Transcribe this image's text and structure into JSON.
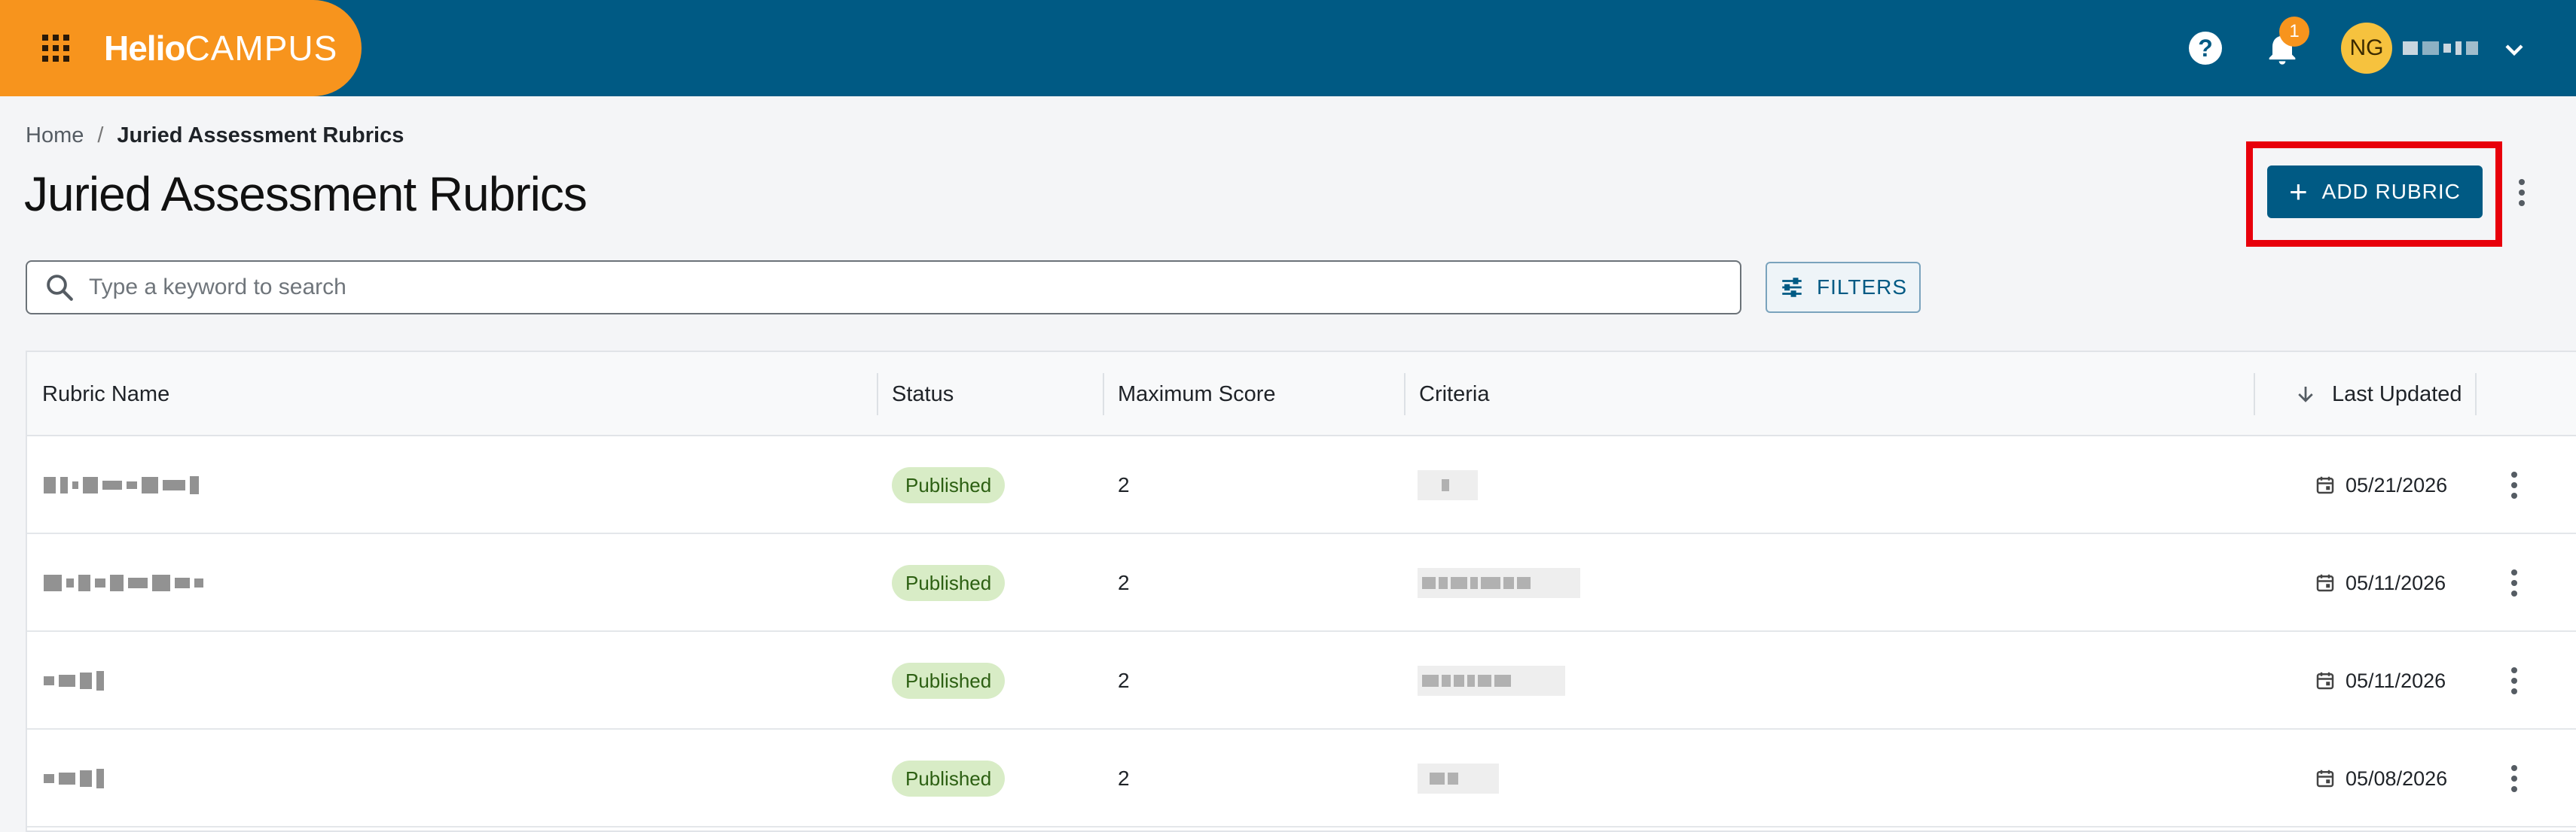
{
  "header": {
    "logo_bold": "Helio",
    "logo_light": "CAMPUS",
    "help_glyph": "?",
    "notification_count": "1",
    "user_initials": "NG"
  },
  "breadcrumb": {
    "home": "Home",
    "separator": "/",
    "current": "Juried Assessment Rubrics"
  },
  "page": {
    "title": "Juried Assessment Rubrics",
    "add_button_label": "ADD RUBRIC",
    "add_button_plus": "+"
  },
  "search": {
    "placeholder": "Type a keyword to search",
    "filters_label": "FILTERS"
  },
  "table": {
    "columns": {
      "name": "Rubric Name",
      "status": "Status",
      "max_score": "Maximum Score",
      "criteria": "Criteria",
      "last_updated": "Last Updated"
    },
    "rows": [
      {
        "status": "Published",
        "max_score": "2",
        "last_updated": "05/21/2026"
      },
      {
        "status": "Published",
        "max_score": "2",
        "last_updated": "05/11/2026"
      },
      {
        "status": "Published",
        "max_score": "2",
        "last_updated": "05/11/2026"
      },
      {
        "status": "Published",
        "max_score": "2",
        "last_updated": "05/08/2026"
      }
    ]
  },
  "colors": {
    "brand_orange": "#f7941d",
    "header_blue": "#005a84",
    "highlight_red": "#e8000b",
    "published_bg": "#d8ecc6"
  },
  "icons": {
    "apps": "apps-grid-icon",
    "help": "help-icon",
    "bell": "bell-icon",
    "search": "search-icon",
    "filters": "filters-icon",
    "sort": "arrow-down-icon",
    "calendar": "calendar-icon",
    "more": "more-vertical-icon"
  }
}
